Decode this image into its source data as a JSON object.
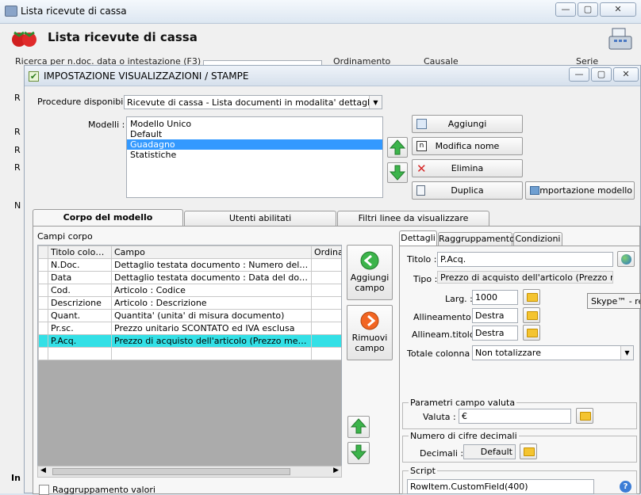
{
  "outer_window": {
    "title": "Lista ricevute di cassa",
    "heading": "Lista ricevute di cassa",
    "filters": {
      "search_label": "Ricerca per n.doc. data o intestazione (F3)",
      "order_label": "Ordinamento",
      "causale_label": "Causale",
      "serie_label": "Serie"
    },
    "tooltip": "Skype™ - re",
    "left_fragments": [
      "R",
      "R",
      "R",
      "R",
      "N",
      "In"
    ]
  },
  "dialog": {
    "title": "IMPOSTAZIONE VISUALIZZAZIONI / STAMPE",
    "procedures_label": "Procedure disponibili :",
    "procedure_selected": "Ricevute di cassa - Lista documenti in modalita' dettaglio",
    "models_label": "Modelli :",
    "models": [
      "Modello Unico",
      "Default",
      "Guadagno",
      "Statistiche"
    ],
    "buttons": {
      "add": "Aggiungi",
      "rename": "Modifica nome",
      "delete": "Elimina",
      "duplicate": "Duplica",
      "import": "Importazione modello"
    },
    "tabs": [
      "Corpo del modello",
      "Utenti abilitati",
      "Filtri linee da visualizzare"
    ],
    "campi_corpo_label": "Campi corpo",
    "grid": {
      "columns": [
        "Titolo colonna",
        "Campo",
        "Ordinar"
      ],
      "rows": [
        {
          "title": "N.Doc.",
          "field": "Dettaglio testata documento : Numero del docume..."
        },
        {
          "title": "Data",
          "field": "Dettaglio testata documento : Data del documento"
        },
        {
          "title": "Cod.",
          "field": "Articolo : Codice"
        },
        {
          "title": "Descrizione",
          "field": "Articolo : Descrizione"
        },
        {
          "title": "Quant.",
          "field": "Quantita' (unita' di misura documento)"
        },
        {
          "title": "Pr.sc.",
          "field": "Prezzo unitario SCONTATO ed IVA esclusa"
        },
        {
          "title": "P.Acq.",
          "field": "Prezzo di acquisto dell'articolo (Prezzo medio FIFO..."
        }
      ]
    },
    "add_field": [
      "Aggiungi",
      "campo"
    ],
    "remove_field": [
      "Rimuovi",
      "campo"
    ],
    "raggruppamento_valori": "Raggruppamento valori",
    "detail_tabs": [
      "Dettagli",
      "Raggruppamento",
      "Condizioni"
    ],
    "detail": {
      "titolo_label": "Titolo :",
      "titolo_value": "P.Acq.",
      "tipo_label": "Tipo :",
      "tipo_value": "Prezzo di acquisto dell'articolo (Prezzo medio FIFO...",
      "larg_label": "Larg. :",
      "larg_value": "1000",
      "allineamento_label": "Allineamento :",
      "allineamento_value": "Destra",
      "allineam_titolo_label": "Allineam.titolo :",
      "allineam_titolo_value": "Destra",
      "totale_label": "Totale colonna :",
      "totale_value": "Non totalizzare",
      "valuta_group": "Parametri campo valuta",
      "valuta_label": "Valuta :",
      "valuta_value": "€",
      "decimali_group": "Numero di cifre decimali",
      "decimali_label": "Decimali :",
      "decimali_value": "Default",
      "script_group": "Script",
      "script_value": "RowItem.CustomField(400)"
    }
  },
  "colors": {
    "selection_blue": "#3399ff",
    "row_highlight": "#33e0e6",
    "arrow_green": "#3cb44b",
    "delete_red": "#d62828"
  }
}
